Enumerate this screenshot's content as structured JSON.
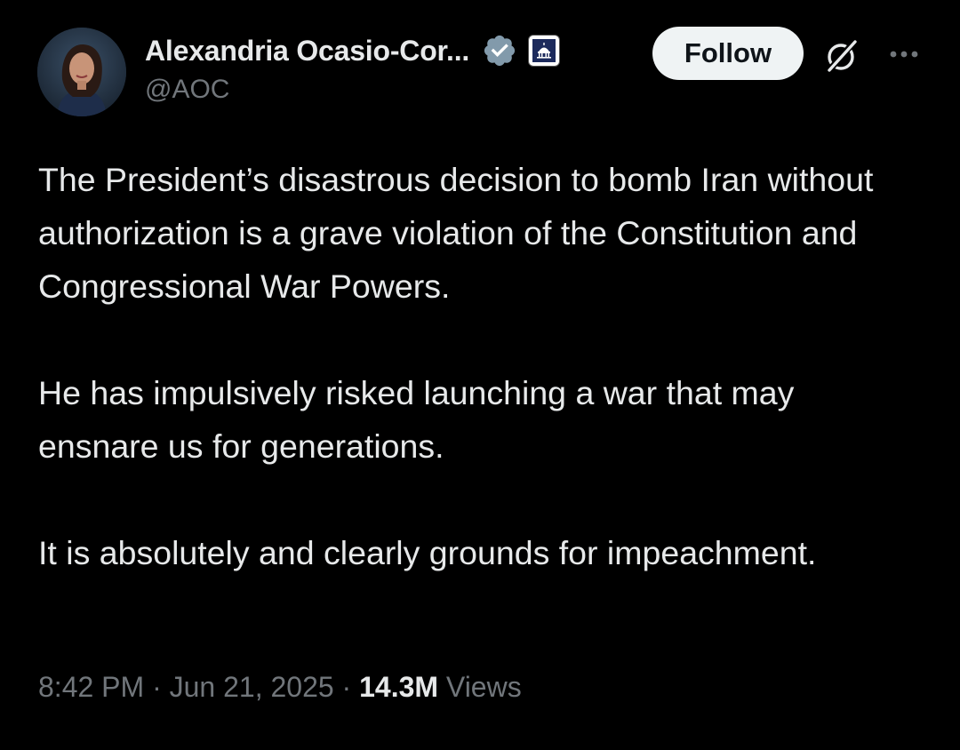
{
  "author": {
    "display_name": "Alexandria Ocasio-Cor...",
    "handle": "@AOC"
  },
  "icons": {
    "verified": "verified-badge-icon",
    "affiliate": "capitol-affiliate-icon",
    "grok": "grok-icon",
    "more": "more-options-icon"
  },
  "colors": {
    "background": "#000000",
    "text": "#e7e9ea",
    "secondary_text": "#71767b",
    "verified_badge": "#829aab",
    "follow_button_bg": "#eff3f4"
  },
  "actions": {
    "follow_label": "Follow"
  },
  "tweet": {
    "paragraphs": [
      "The President’s disastrous decision to bomb Iran without authorization is a grave violation of the Constitution and Congressional War Powers.",
      "He has impulsively risked launching a war that may ensnare us for generations.",
      "It is absolutely and clearly grounds for impeachment."
    ]
  },
  "meta": {
    "time": "8:42 PM",
    "separator": "·",
    "date": "Jun 21, 2025",
    "views_count": "14.3M",
    "views_label": "Views"
  }
}
